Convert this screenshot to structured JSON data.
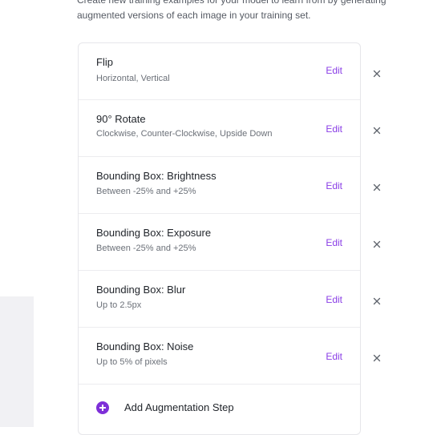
{
  "intro": {
    "line1": "Create new training examples for your model to learn from by generating",
    "line2": "augmented versions of each image in your training set."
  },
  "steps": [
    {
      "title": "Flip",
      "detail": "Horizontal, Vertical",
      "edit_label": "Edit",
      "remove_label": "×"
    },
    {
      "title": "90° Rotate",
      "detail": "Clockwise, Counter-Clockwise, Upside Down",
      "edit_label": "Edit",
      "remove_label": "×"
    },
    {
      "title": "Bounding Box: Brightness",
      "detail": "Between -25% and +25%",
      "edit_label": "Edit",
      "remove_label": "×"
    },
    {
      "title": "Bounding Box: Exposure",
      "detail": "Between -25% and +25%",
      "edit_label": "Edit",
      "remove_label": "×"
    },
    {
      "title": "Bounding Box: Blur",
      "detail": "Up to 2.5px",
      "edit_label": "Edit",
      "remove_label": "×"
    },
    {
      "title": "Bounding Box: Noise",
      "detail": "Up to 5% of pixels",
      "edit_label": "Edit",
      "remove_label": "×"
    }
  ],
  "add_step": {
    "label": "Add Augmentation Step",
    "icon": "plus-circle-icon"
  },
  "colors": {
    "accent": "#8a3ee6",
    "text": "#1f2329",
    "muted": "#6b7078",
    "border": "#e6e6ea"
  }
}
